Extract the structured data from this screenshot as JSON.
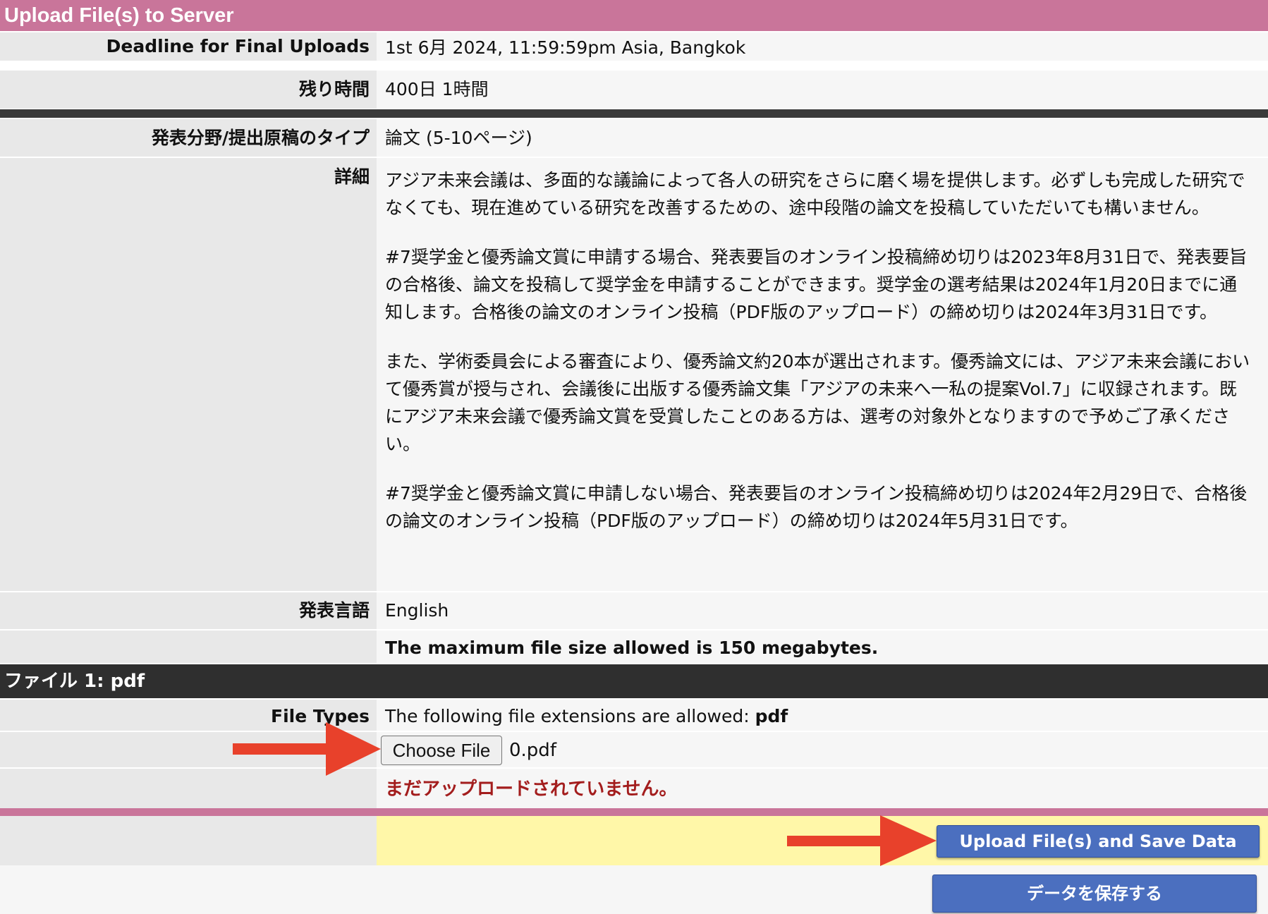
{
  "header": {
    "title": "Upload File(s) to Server"
  },
  "deadline": {
    "label": "Deadline for Final Uploads",
    "value": "1st 6月 2024, 11:59:59pm Asia, Bangkok"
  },
  "remaining": {
    "label": "残り時間",
    "value": "400日 1時間"
  },
  "type": {
    "label": "発表分野/提出原稿のタイプ",
    "value": "論文 (5-10ページ)"
  },
  "details": {
    "label": "詳細",
    "paragraphs": [
      "アジア未来会議は、多面的な議論によって各人の研究をさらに磨く場を提供します。必ずしも完成した研究でなくても、現在進めている研究を改善するための、途中段階の論文を投稿していただいても構いません。",
      "#7奨学金と優秀論文賞に申請する場合、発表要旨のオンライン投稿締め切りは2023年8月31日で、発表要旨の合格後、論文を投稿して奨学金を申請することができます。奨学金の選考結果は2024年1月20日までに通知します。合格後の論文のオンライン投稿（PDF版のアップロード）の締め切りは2024年3月31日です。",
      "また、学術委員会による審査により、優秀論文約20本が選出されます。優秀論文には、アジア未来会議において優秀賞が授与され、会議後に出版する優秀論文集「アジアの未来へ一私の提案Vol.7」に収録されます。既にアジア未来会議で優秀論文賞を受賞したことのある方は、選考の対象外となりますので予めご了承ください。",
      "#7奨学金と優秀論文賞に申請しない場合、発表要旨のオンライン投稿締め切りは2024年2月29日で、合格後の論文のオンライン投稿（PDF版のアップロード）の締め切りは2024年5月31日です。"
    ]
  },
  "language": {
    "label": "発表言語",
    "value": "English"
  },
  "max_size": {
    "text": "The maximum file size allowed is 150 megabytes."
  },
  "file1": {
    "title": "ファイル 1: pdf",
    "types_label": "File Types",
    "types_prefix": "The following file extensions are allowed:",
    "types_ext": "pdf",
    "choose_label": "Choose File",
    "chosen": "0.pdf",
    "status": "まだアップロードされていません。"
  },
  "actions": {
    "upload_label": "Upload File(s) and Save Data",
    "save_label": "データを保存する"
  },
  "colors": {
    "title_bar": "#c9759a",
    "dark_bar": "#2f2f2f",
    "highlight": "#fff7a8",
    "button_blue": "#4b6fbf",
    "error_red": "#a31d1d",
    "arrow_red": "#e8412b"
  }
}
